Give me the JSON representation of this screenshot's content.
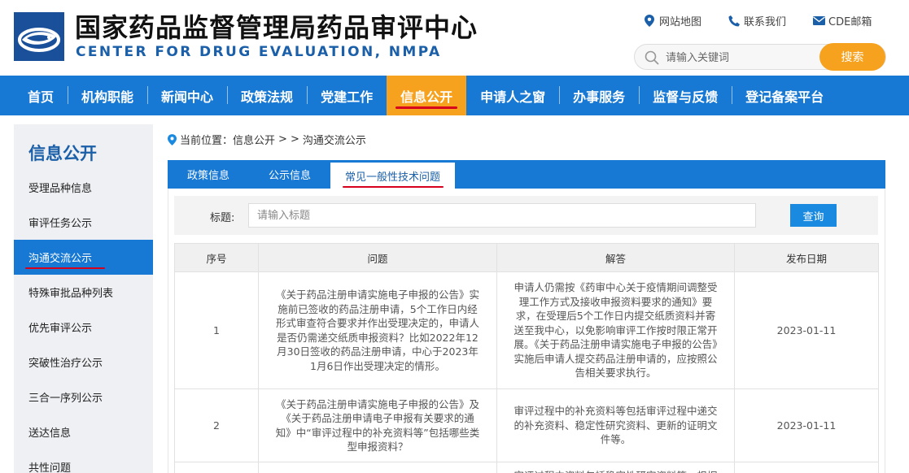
{
  "header": {
    "title_cn": "国家药品监督管理局药品审评中心",
    "title_en": "CENTER FOR DRUG EVALUATION, NMPA",
    "links": [
      {
        "label": "网站地图",
        "icon": "map-pin-icon"
      },
      {
        "label": "联系我们",
        "icon": "phone-icon"
      },
      {
        "label": "CDE邮箱",
        "icon": "mail-icon"
      }
    ],
    "search_placeholder": "请输入关键词",
    "search_button": "搜索"
  },
  "nav": {
    "items": [
      "首页",
      "机构职能",
      "新闻中心",
      "政策法规",
      "党建工作",
      "信息公开",
      "申请人之窗",
      "办事服务",
      "监督与反馈",
      "登记备案平台"
    ],
    "active_index": 5
  },
  "sidebar": {
    "title": "信息公开",
    "items": [
      "受理品种信息",
      "审评任务公示",
      "沟通交流公示",
      "特殊审批品种列表",
      "优先审评公示",
      "突破性治疗公示",
      "三合一序列公示",
      "送达信息",
      "共性问题"
    ],
    "active_index": 2
  },
  "breadcrumb": {
    "prefix": "当前位置：",
    "items": [
      "信息公开",
      ">",
      ">",
      "沟通交流公示"
    ]
  },
  "tabs": {
    "items": [
      "政策信息",
      "公示信息",
      "常见一般性技术问题"
    ],
    "active_index": 2
  },
  "filter": {
    "label": "标题:",
    "placeholder": "请输入标题",
    "button": "查询"
  },
  "table": {
    "headers": [
      "序号",
      "问题",
      "解答",
      "发布日期"
    ],
    "rows": [
      {
        "num": "1",
        "question": "《关于药品注册申请实施电子申报的公告》实施前已签收的药品注册申请，5个工作日内经形式审查符合要求并作出受理决定的，申请人是否仍需递交纸质申报资料？比如2022年12月30日签收的药品注册申请，中心于2023年1月6日作出受理决定的情形。",
        "answer": "申请人仍需按《药审中心关于疫情期间调整受理工作方式及接收申报资料要求的通知》要求，在受理后5个工作日内提交纸质资料并寄送至我中心，以免影响审评工作按时限正常开展。《关于药品注册申请实施电子申报的公告》实施后申请人提交药品注册申请的，应按照公告相关要求执行。",
        "date": "2023-01-11"
      },
      {
        "num": "2",
        "question": "《关于药品注册申请实施电子申报的公告》及《关于药品注册申请电子申报有关要求的通知》中“审评过程中的补充资料等”包括哪些类型申报资料？",
        "answer": "审评过程中的补充资料等包括审评过程中递交的补充资料、稳定性研究资料、更新的证明文件等。",
        "date": "2023-01-11"
      },
      {
        "num": "",
        "question": "",
        "answer": "审评过程中资料包括稳定性研究资料等，根据",
        "date": ""
      }
    ]
  },
  "colors": {
    "primary_blue": "#1879d4",
    "accent_orange": "#f6a21e",
    "underline_red": "#d6001c",
    "title_blue": "#1a5fa8"
  }
}
